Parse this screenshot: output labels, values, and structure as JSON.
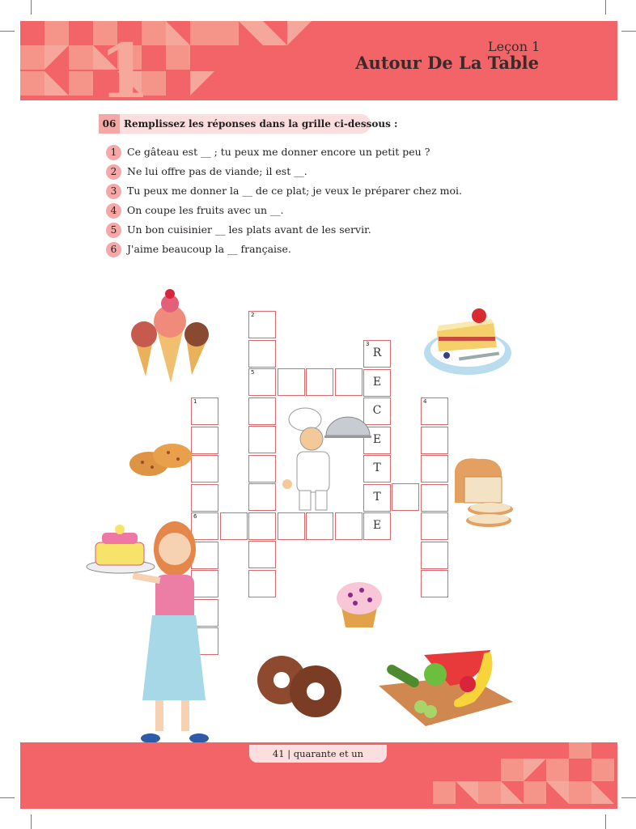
{
  "header": {
    "chapter_number": "1",
    "lesson_label": "Leçon 1",
    "lesson_title": "Autour De La Table",
    "color": "#f26468"
  },
  "exercise": {
    "number": "06",
    "instruction": "Remplissez les réponses dans la grille ci-dessous :",
    "questions": [
      {
        "num": "1",
        "text": "Ce gâteau est __ ; tu peux me donner encore un petit peu ?"
      },
      {
        "num": "2",
        "text": "Ne lui offre pas de viande; il est __."
      },
      {
        "num": "3",
        "text": "Tu peux me donner la __ de ce plat; je veux le préparer chez moi."
      },
      {
        "num": "4",
        "text": "On coupe les fruits avec un __."
      },
      {
        "num": "5",
        "text": "Un bon cuisinier __ les plats avant de les servir."
      },
      {
        "num": "6",
        "text": "J'aime beaucoup la __ française."
      }
    ]
  },
  "crossword": {
    "clue_numbers": [
      "1",
      "2",
      "3",
      "4",
      "5",
      "6"
    ],
    "filled_answer": [
      "R",
      "E",
      "C",
      "E",
      "T",
      "T",
      "E"
    ]
  },
  "illustrations": [
    "ice-cream-cones",
    "cake-slice",
    "cookies",
    "chef-with-cloche",
    "bread-loaf",
    "woman-with-cake",
    "muffin",
    "donuts",
    "fruit-board"
  ],
  "footer": {
    "page_number": "41",
    "separator": "|",
    "page_words": "quarante et un"
  }
}
